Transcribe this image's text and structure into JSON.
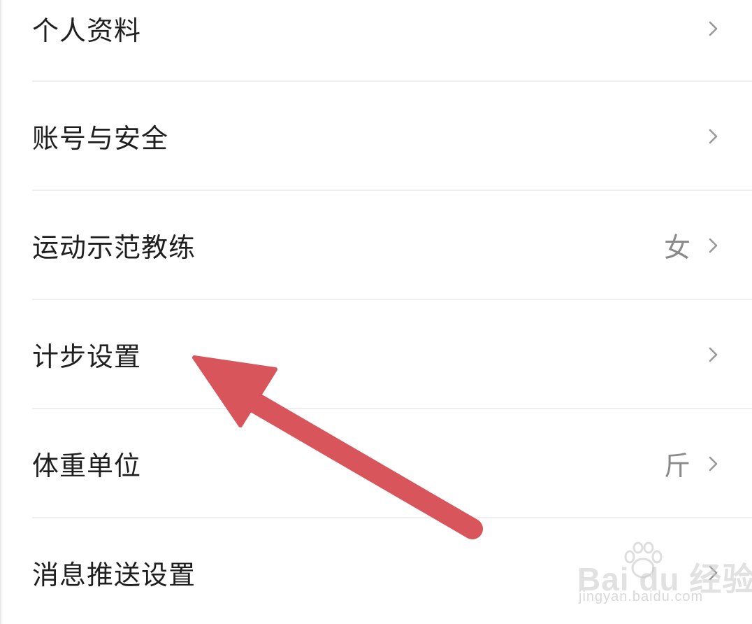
{
  "settings": {
    "items": [
      {
        "label": "个人资料",
        "value": ""
      },
      {
        "label": "账号与安全",
        "value": ""
      },
      {
        "label": "运动示范教练",
        "value": "女"
      },
      {
        "label": "计步设置",
        "value": ""
      },
      {
        "label": "体重单位",
        "value": "斤"
      },
      {
        "label": "消息推送设置",
        "value": ""
      }
    ]
  },
  "icons": {
    "chevron": "chevron-right-icon",
    "overlay": "arrow-annotation"
  },
  "colors": {
    "label": "#1f1f1f",
    "value": "#8a8a8a",
    "chevron": "#9a9a9a",
    "divider": "#eeeeee",
    "arrow": "#d9555c"
  },
  "watermark": {
    "brand": "Bai du 经验",
    "url": "jingyan.baidu.com"
  }
}
